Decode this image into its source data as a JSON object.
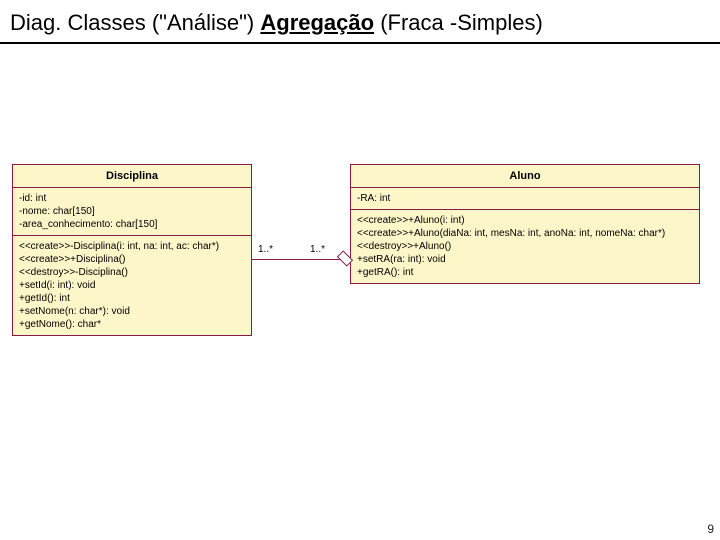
{
  "title": {
    "prefix": "Diag. Classes (\"Análise\") ",
    "aggregation_word": "Agregação",
    "suffix": " (Fraca -Simples)"
  },
  "classes": {
    "disciplina": {
      "name": "Disciplina",
      "attrs": "-id: int\n-nome: char[150]\n-area_conhecimento: char[150]",
      "ops": "<<create>>-Disciplina(i: int, na: int, ac: char*)\n<<create>>+Disciplina()\n<<destroy>>-Disciplina()\n+setId(i: int): void\n+getId(): int\n+setNome(n: char*): void\n+getNome(): char*"
    },
    "aluno": {
      "name": "Aluno",
      "attrs": "-RA: int",
      "ops": "<<create>>+Aluno(i: int)\n<<create>>+Aluno(diaNa: int, mesNa: int, anoNa: int, nomeNa: char*)\n<<destroy>>+Aluno()\n+setRA(ra: int): void\n+getRA(): int"
    }
  },
  "association": {
    "left_multiplicity": "1..*",
    "right_multiplicity": "1..*"
  },
  "page_number": "9",
  "chart_data": {
    "type": "diagram",
    "diagram_type": "uml_class_diagram",
    "title": "Diag. Classes (\"Análise\") Agregação (Fraca -Simples)",
    "classes": [
      {
        "name": "Disciplina",
        "attributes": [
          {
            "visibility": "-",
            "name": "id",
            "type": "int"
          },
          {
            "visibility": "-",
            "name": "nome",
            "type": "char[150]"
          },
          {
            "visibility": "-",
            "name": "area_conhecimento",
            "type": "char[150]"
          }
        ],
        "operations": [
          {
            "stereotype": "create",
            "visibility": "-",
            "signature": "Disciplina(i: int, na: int, ac: char*)"
          },
          {
            "stereotype": "create",
            "visibility": "+",
            "signature": "Disciplina()"
          },
          {
            "stereotype": "destroy",
            "visibility": "-",
            "signature": "Disciplina()"
          },
          {
            "visibility": "+",
            "signature": "setId(i: int): void"
          },
          {
            "visibility": "+",
            "signature": "getId(): int"
          },
          {
            "visibility": "+",
            "signature": "setNome(n: char*): void"
          },
          {
            "visibility": "+",
            "signature": "getNome(): char*"
          }
        ]
      },
      {
        "name": "Aluno",
        "attributes": [
          {
            "visibility": "-",
            "name": "RA",
            "type": "int"
          }
        ],
        "operations": [
          {
            "stereotype": "create",
            "visibility": "+",
            "signature": "Aluno(i: int)"
          },
          {
            "stereotype": "create",
            "visibility": "+",
            "signature": "Aluno(diaNa: int, mesNa: int, anoNa: int, nomeNa: char*)"
          },
          {
            "stereotype": "destroy",
            "visibility": "+",
            "signature": "Aluno()"
          },
          {
            "visibility": "+",
            "signature": "setRA(ra: int): void"
          },
          {
            "visibility": "+",
            "signature": "getRA(): int"
          }
        ]
      }
    ],
    "relationships": [
      {
        "type": "aggregation",
        "whole": "Aluno",
        "part": "Disciplina",
        "multiplicity_whole": "1..*",
        "multiplicity_part": "1..*"
      }
    ]
  }
}
